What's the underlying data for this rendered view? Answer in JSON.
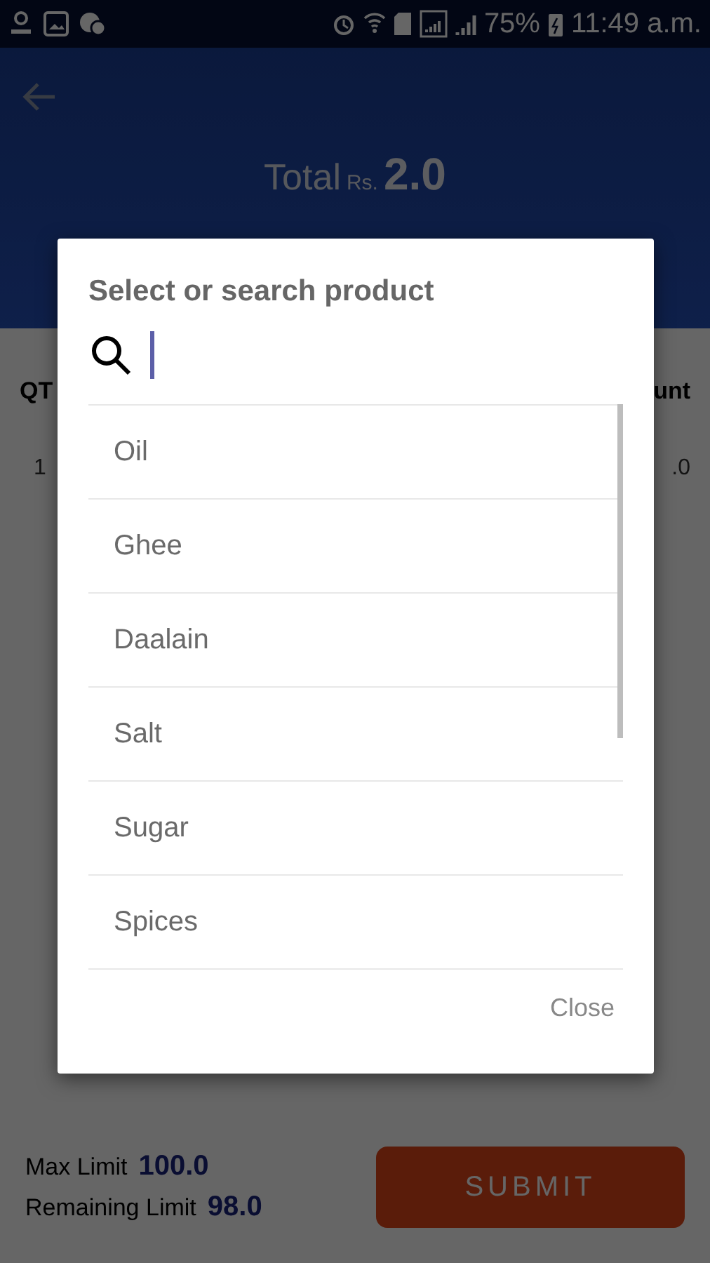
{
  "status_bar": {
    "battery": "75%",
    "time": "11:49 a.m."
  },
  "header": {
    "total_label": "Total",
    "currency": "Rs.",
    "total": "2.0"
  },
  "table": {
    "columns": [
      "QT",
      "unt"
    ],
    "rows": [
      [
        "1",
        ".0"
      ]
    ]
  },
  "footer": {
    "max_limit_label": "Max Limit",
    "max_limit": "100.0",
    "remaining_label": "Remaining Limit",
    "remaining": "98.0",
    "submit": "SUBMIT"
  },
  "dialog": {
    "title": "Select or search product",
    "items": [
      "Oil",
      "Ghee",
      "Daalain",
      "Salt",
      "Sugar",
      "Spices"
    ],
    "close": "Close"
  }
}
